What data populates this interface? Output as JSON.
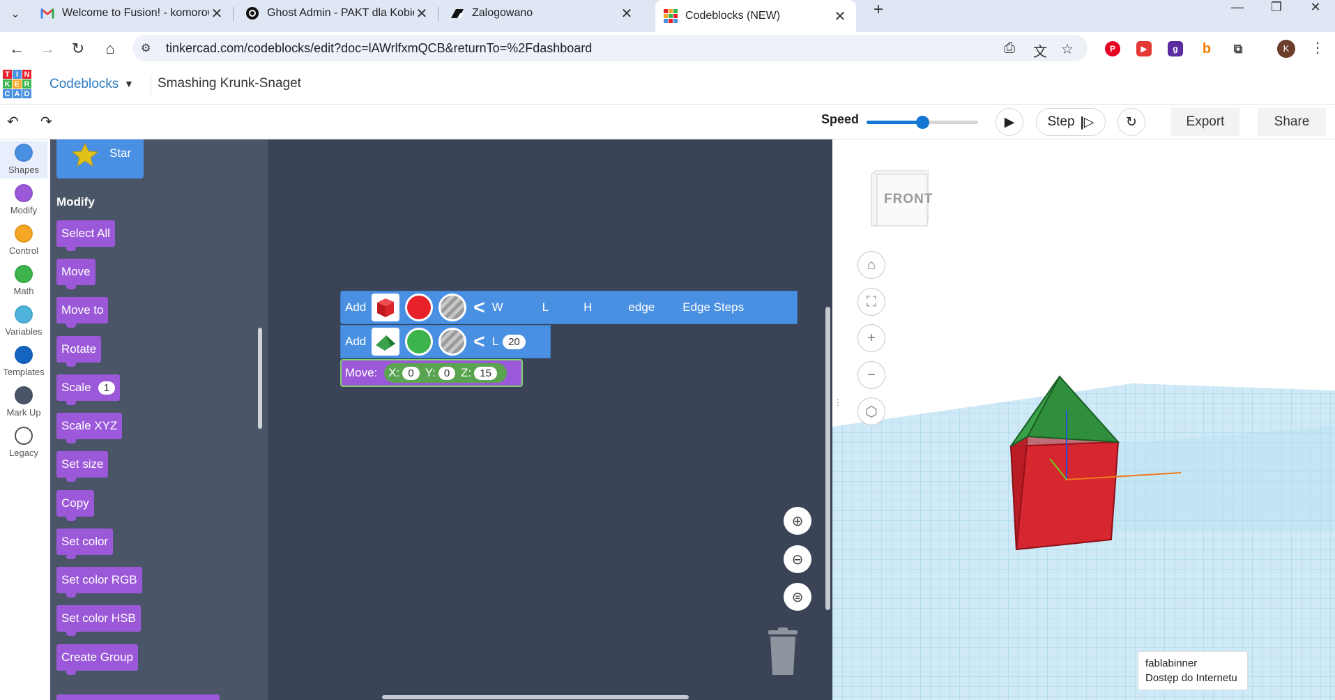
{
  "browser": {
    "tabs": [
      {
        "title": "Welcome to Fusion! - komorow",
        "favicon": "gmail-icon"
      },
      {
        "title": "Ghost Admin - PAKT dla Kobiet",
        "favicon": "ghost-icon"
      },
      {
        "title": "Zalogowano",
        "favicon": "zalogowano-icon"
      },
      {
        "title": "Codeblocks (NEW)",
        "favicon": "tinkercad-icon"
      }
    ],
    "new_tab": "+",
    "window_controls": {
      "minimize": "—",
      "maximize": "❐",
      "close": "✕"
    },
    "url": "tinkercad.com/codeblocks/edit?doc=lAWrlfxmQCB&returnTo=%2Fdashboard",
    "profile_initial": "K"
  },
  "app": {
    "logo_letters": [
      "T",
      "I",
      "N",
      "K",
      "E",
      "R",
      "C",
      "A",
      "D"
    ],
    "name": "Codeblocks",
    "doc_title": "Smashing Krunk-Snaget"
  },
  "toolbar": {
    "speed_label": "Speed",
    "speed_value": 0.5,
    "step_label": "Step",
    "export_label": "Export",
    "share_label": "Share"
  },
  "categories": [
    {
      "label": "Shapes",
      "color": "#4a90e2"
    },
    {
      "label": "Modify",
      "color": "#9b59d9"
    },
    {
      "label": "Control",
      "color": "#f5a623"
    },
    {
      "label": "Math",
      "color": "#3cb44b"
    },
    {
      "label": "Variables",
      "color": "#4fb3dd"
    },
    {
      "label": "Templates",
      "color": "#1565c0"
    },
    {
      "label": "Mark Up",
      "color": "#4a5568"
    },
    {
      "label": "Legacy",
      "color": "#ffffff"
    }
  ],
  "flyout": {
    "star_label": "Star",
    "modify_title": "Modify",
    "blocks": [
      {
        "label": "Select All"
      },
      {
        "label": "Move"
      },
      {
        "label": "Move to"
      },
      {
        "label": "Rotate"
      },
      {
        "label": "Scale",
        "value": "1"
      },
      {
        "label": "Scale XYZ"
      },
      {
        "label": "Set size"
      },
      {
        "label": "Copy"
      },
      {
        "label": "Set color"
      },
      {
        "label": "Set color RGB"
      },
      {
        "label": "Set color HSB"
      },
      {
        "label": "Create Group"
      }
    ]
  },
  "workspace": {
    "add1": {
      "label": "Add",
      "params": [
        "W",
        "L",
        "H",
        "edge",
        "Edge Steps"
      ],
      "shape_color": "#d9262b",
      "color": "#e8202a"
    },
    "add2": {
      "label": "Add",
      "param": "L",
      "value": "20",
      "shape_color": "#3aa14a",
      "color": "#3cb44b"
    },
    "move": {
      "label": "Move:",
      "x_label": "X:",
      "x": "0",
      "y_label": "Y:",
      "y": "0",
      "z_label": "Z:",
      "z": "15"
    }
  },
  "viewport": {
    "cube_label": "FRONT",
    "tooltip_line1": "fablabinner",
    "tooltip_line2": "Dostęp do Internetu"
  }
}
